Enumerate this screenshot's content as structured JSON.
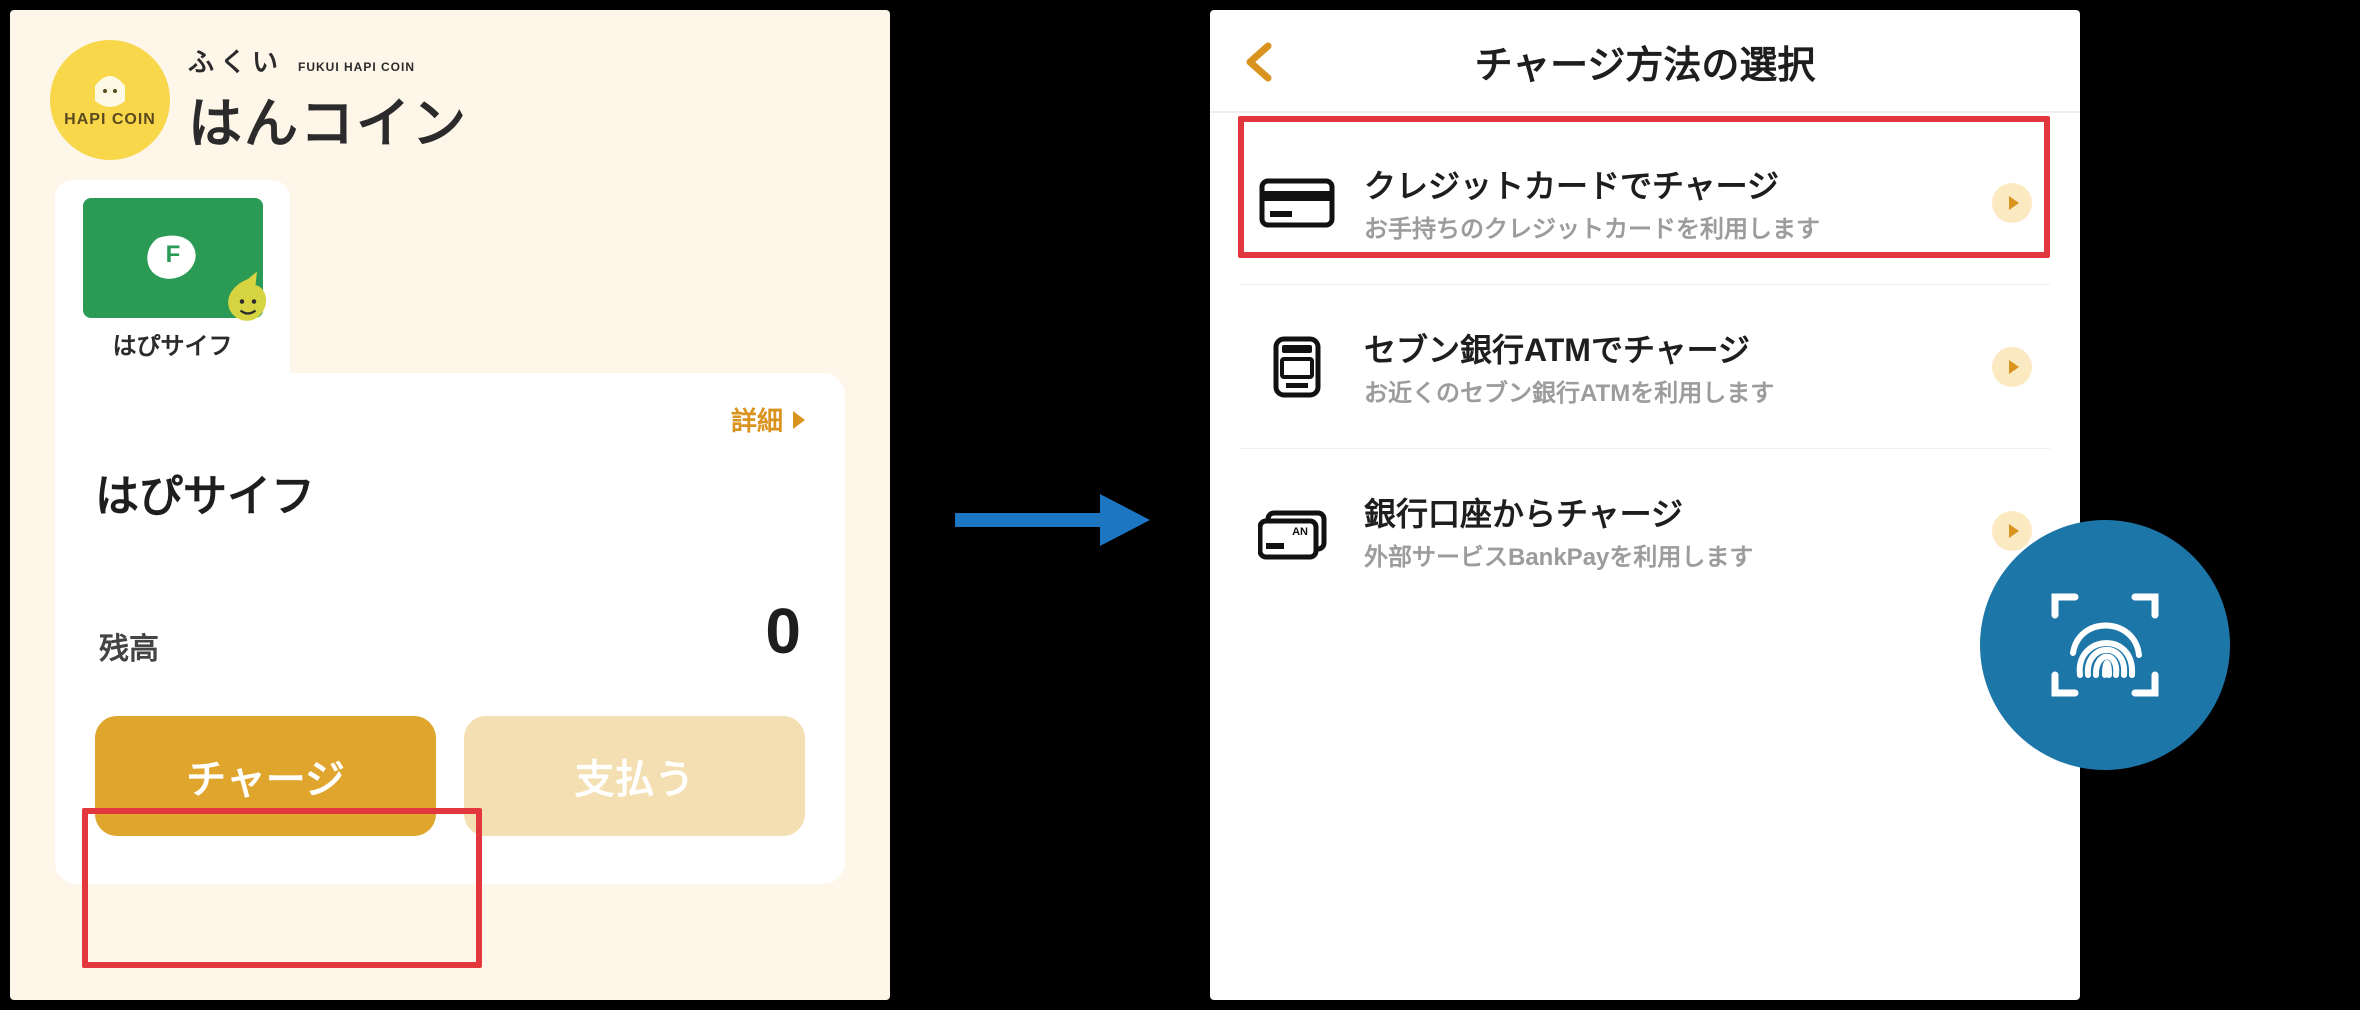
{
  "brand": {
    "badge_label": "HAPI COIN",
    "furigana": "ふくい",
    "sub_en": "FUKUI HAPI COIN",
    "logo_text": "はんコイン"
  },
  "wallet": {
    "tab_label": "はぴサイフ",
    "title": "はぴサイフ",
    "detail_label": "詳細",
    "balance_label": "残高",
    "balance_value": "0",
    "charge_label": "チャージ",
    "pay_label": "支払う"
  },
  "charge_screen": {
    "title": "チャージ方法の選択",
    "options": [
      {
        "title": "クレジットカードでチャージ",
        "sub": "お手持ちのクレジットカードを利用します",
        "icon": "credit-card-icon"
      },
      {
        "title": "セブン銀行ATMでチャージ",
        "sub": "お近くのセブン銀行ATMを利用します",
        "icon": "atm-icon"
      },
      {
        "title": "銀行口座からチャージ",
        "sub": "外部サービスBankPayを利用します",
        "icon": "bank-account-icon"
      }
    ]
  }
}
